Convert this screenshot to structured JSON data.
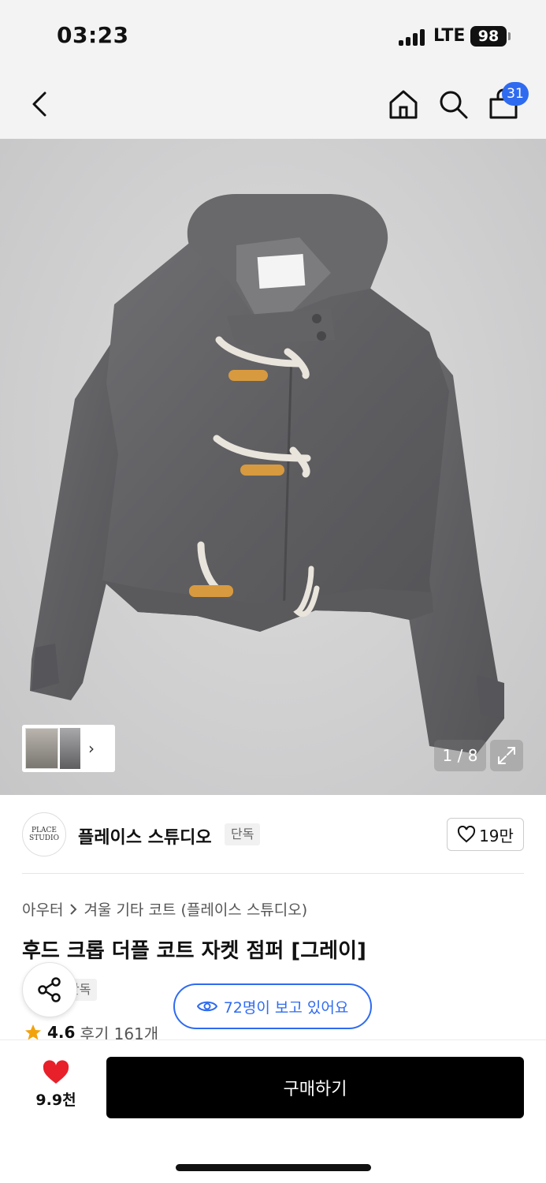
{
  "status_bar": {
    "time": "03:23",
    "network": "LTE",
    "battery": "98"
  },
  "nav": {
    "back_icon": "chevron-left-icon",
    "home_icon": "home-icon",
    "search_icon": "search-icon",
    "cart_icon": "shopping-bag-icon",
    "cart_count": "31"
  },
  "gallery": {
    "page_indicator": "1 / 8",
    "thumb_arrow": "›"
  },
  "brand": {
    "logo_text": "PLACE STUDIO",
    "name": "플레이스 스튜디오",
    "tag": "단독",
    "likes": "19만"
  },
  "product": {
    "breadcrumb": [
      "아우터",
      "겨울 기타 코트 (플레이스 스튜디오)"
    ],
    "title": "후드 크롭 더플 코트 자켓 점퍼 [그레이]",
    "tag": "단독",
    "viewers": "72명이 보고 있어요",
    "rating": "4.6",
    "reviews": "후기 161개"
  },
  "bottom_bar": {
    "favorite_count": "9.9천",
    "buy_label": "구매하기"
  },
  "colors": {
    "accent_blue": "#2f6bf0",
    "heart_red": "#e8202a",
    "star_orange": "#f2a20c"
  }
}
